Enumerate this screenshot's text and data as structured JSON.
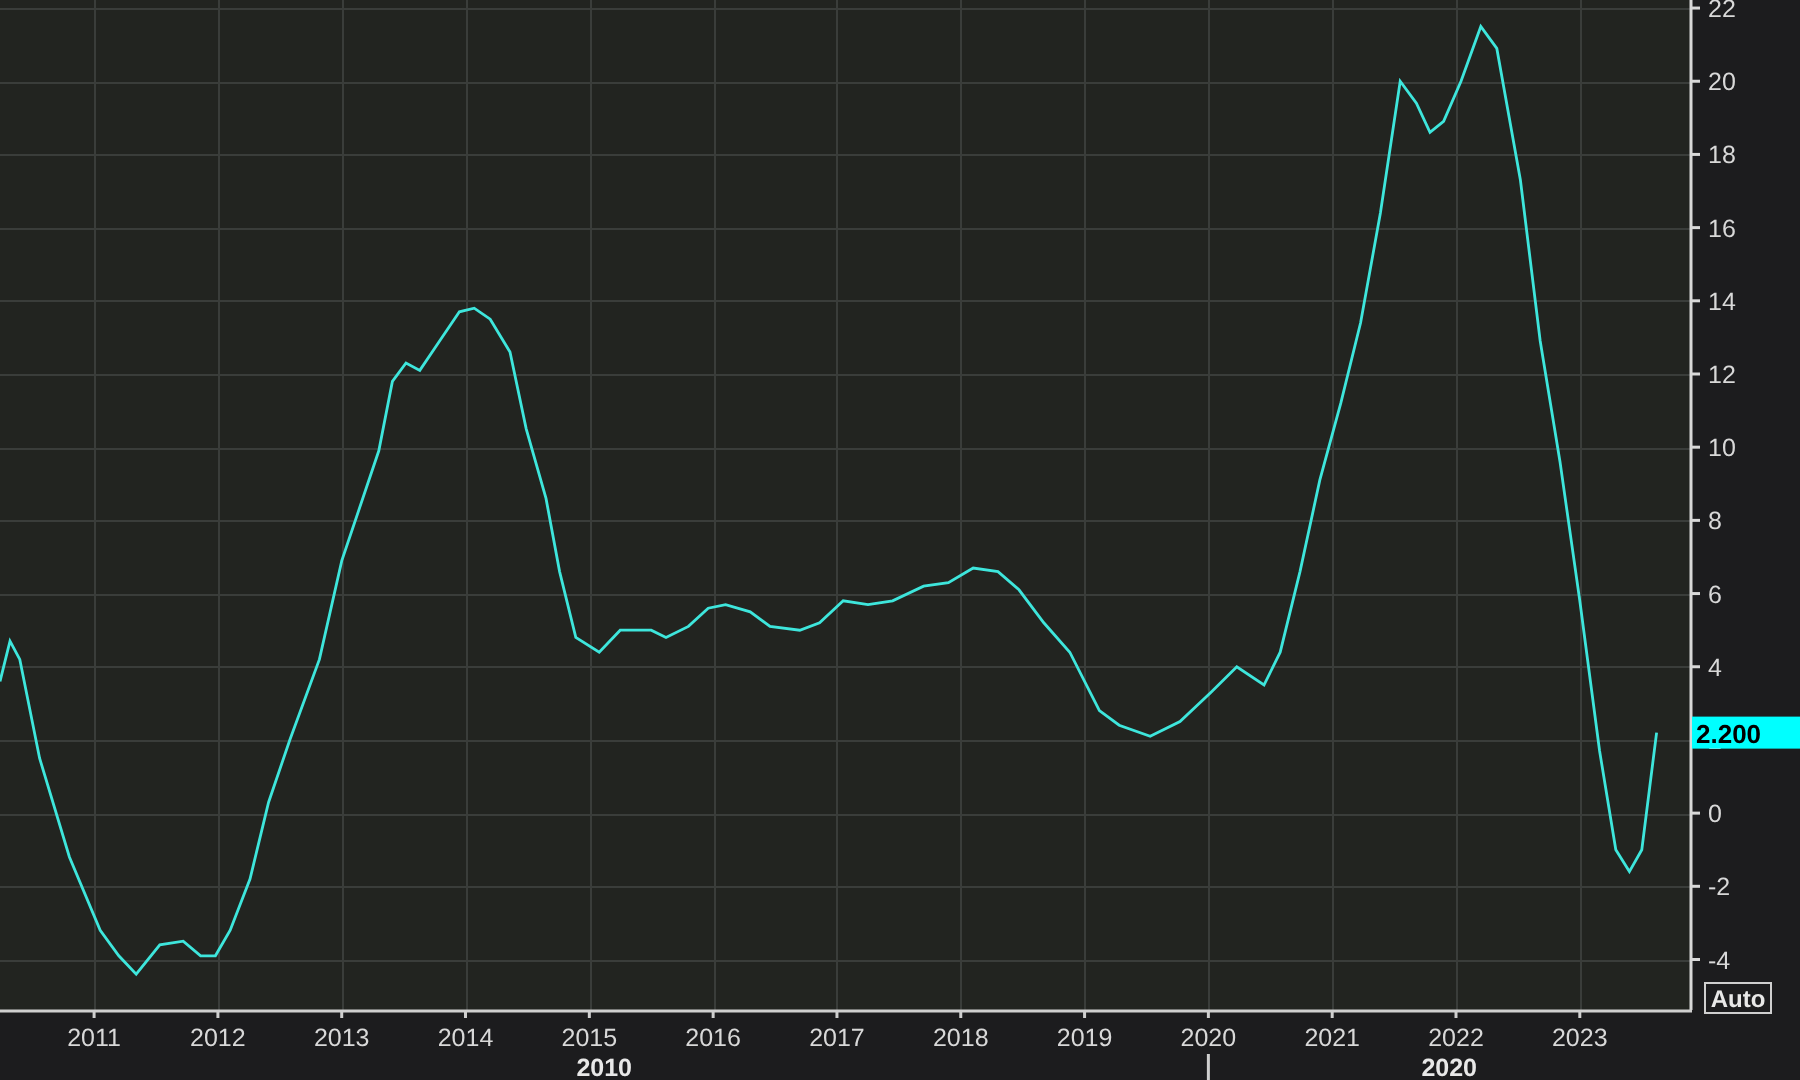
{
  "chart_data": {
    "type": "line",
    "x": [
      2010.24,
      2010.32,
      2010.4,
      2010.56,
      2010.8,
      2011.05,
      2011.2,
      2011.34,
      2011.53,
      2011.72,
      2011.86,
      2011.98,
      2012.1,
      2012.26,
      2012.41,
      2012.58,
      2012.82,
      2013.0,
      2013.3,
      2013.41,
      2013.52,
      2013.63,
      2013.79,
      2013.95,
      2014.07,
      2014.2,
      2014.36,
      2014.49,
      2014.65,
      2014.76,
      2014.89,
      2015.08,
      2015.25,
      2015.5,
      2015.62,
      2015.8,
      2015.96,
      2016.1,
      2016.3,
      2016.46,
      2016.7,
      2016.86,
      2017.05,
      2017.25,
      2017.45,
      2017.7,
      2017.9,
      2018.1,
      2018.3,
      2018.47,
      2018.67,
      2018.88,
      2019.12,
      2019.28,
      2019.53,
      2019.77,
      2020.02,
      2020.23,
      2020.45,
      2020.58,
      2020.74,
      2020.9,
      2021.07,
      2021.23,
      2021.39,
      2021.55,
      2021.68,
      2021.79,
      2021.9,
      2022.04,
      2022.2,
      2022.33,
      2022.52,
      2022.68,
      2022.84,
      2023.0,
      2023.16,
      2023.29,
      2023.4,
      2023.5,
      2023.62
    ],
    "series": [
      {
        "color": "#3ee6dc",
        "values": [
          3.6,
          4.7,
          4.2,
          1.5,
          -1.2,
          -3.2,
          -3.9,
          -4.4,
          -3.6,
          -3.5,
          -3.9,
          -3.9,
          -3.2,
          -1.8,
          0.3,
          2.0,
          4.2,
          6.9,
          9.9,
          11.8,
          12.3,
          12.1,
          12.9,
          13.7,
          13.8,
          13.5,
          12.6,
          10.5,
          8.6,
          6.6,
          4.8,
          4.4,
          5.0,
          5.0,
          4.8,
          5.1,
          5.6,
          5.7,
          5.5,
          5.1,
          5.0,
          5.2,
          5.8,
          5.7,
          5.8,
          6.2,
          6.3,
          6.7,
          6.6,
          6.1,
          5.2,
          4.4,
          2.8,
          2.4,
          2.1,
          2.5,
          3.3,
          4.0,
          3.5,
          4.4,
          6.6,
          9.1,
          11.2,
          13.4,
          16.4,
          20.0,
          19.4,
          18.6,
          18.9,
          20.0,
          21.5,
          20.9,
          17.3,
          12.9,
          9.6,
          5.8,
          1.7,
          -1.0,
          -1.6,
          -1.0,
          2.2
        ]
      }
    ],
    "xlim": [
      2010.24,
      2023.89
    ],
    "ylim": [
      -5.38,
      22.22
    ],
    "xticks": [
      2011,
      2012,
      2013,
      2014,
      2015,
      2016,
      2017,
      2018,
      2019,
      2020,
      2021,
      2022,
      2023
    ],
    "yticks": [
      -4,
      -2,
      0,
      2,
      4,
      6,
      8,
      10,
      12,
      14,
      16,
      18,
      20,
      22
    ],
    "grid": true
  },
  "decade_labels": [
    "2010",
    "2020"
  ],
  "last_value_tag": "2.200",
  "scale_button": "Auto"
}
